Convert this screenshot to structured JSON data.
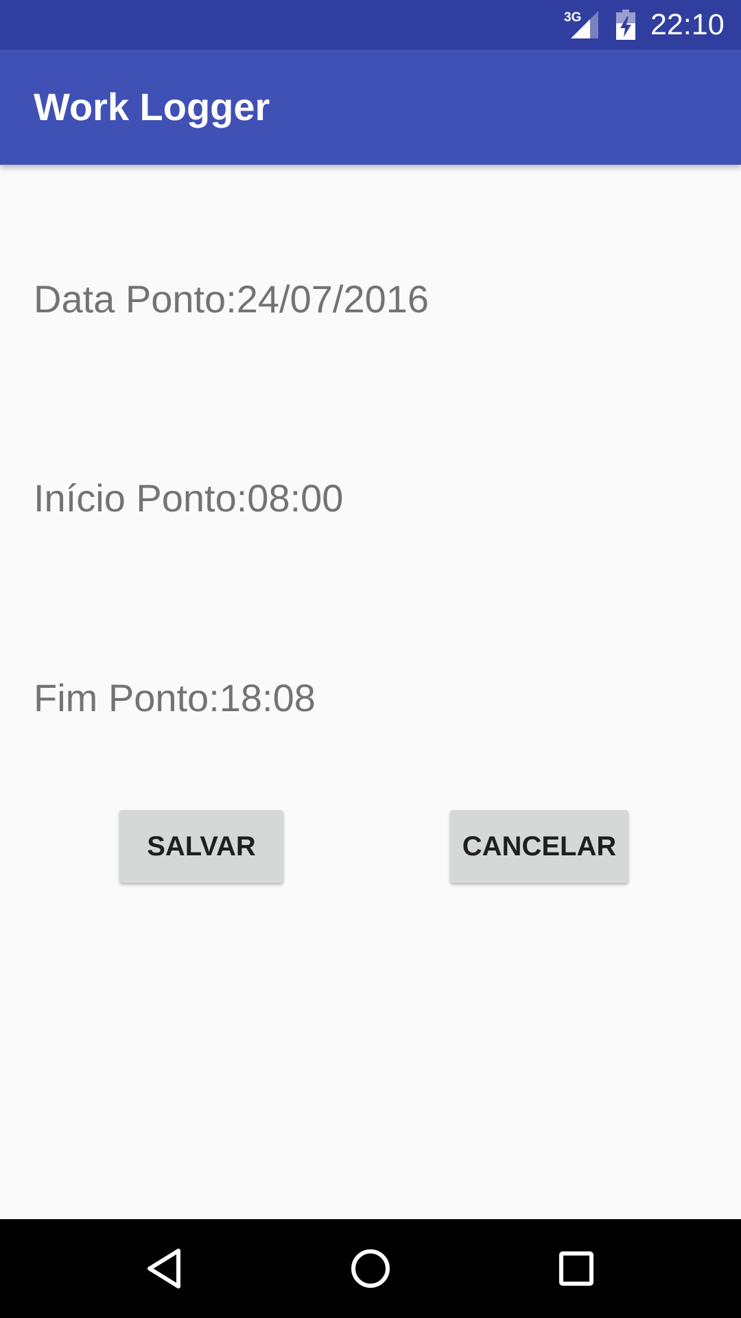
{
  "status_bar": {
    "network": "3G",
    "time": "22:10",
    "icons": [
      "network-3g-signal-icon",
      "battery-charging-icon"
    ]
  },
  "app_bar": {
    "title": "Work Logger"
  },
  "form": {
    "date_line": "Data Ponto:24/07/2016",
    "start_line": "Início Ponto:08:00",
    "end_line": "Fim Ponto:18:08"
  },
  "buttons": {
    "save_label": "SALVAR",
    "cancel_label": "CANCELAR"
  },
  "nav_bar": {
    "icons": [
      "back-icon",
      "home-icon",
      "recents-icon"
    ]
  },
  "colors": {
    "status_bar": "#303f9f",
    "app_bar": "#3f51b5",
    "background": "#fafafa",
    "text_secondary": "#737373",
    "button_bg": "#d6d7d7",
    "button_text": "#1f1f1f",
    "nav_bar": "#000000"
  }
}
